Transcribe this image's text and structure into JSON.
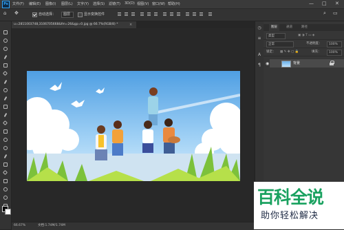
{
  "app": {
    "logo": "Ps"
  },
  "menu": [
    "文件(F)",
    "编辑(E)",
    "图像(I)",
    "图层(L)",
    "文字(Y)",
    "选择(S)",
    "滤镜(T)",
    "3D(D)",
    "视图(V)",
    "窗口(W)",
    "帮助(H)"
  ],
  "window_controls": {
    "minimize": "—",
    "maximize": "□",
    "close": "✕"
  },
  "options": {
    "auto_select_label": "自动选择：",
    "auto_select_value": "图层",
    "show_transform_label": "显示变换控件"
  },
  "document": {
    "tab_title": "u=2811003748,3106705668&fm=26&gp=0.jpg @ 66.7%(RGB/8) *",
    "tab_close": "×"
  },
  "status": {
    "zoom": "66.67%",
    "doc_info": "文档:1.74M/1.74M"
  },
  "panel": {
    "tabs": [
      "图层",
      "通道",
      "路径"
    ],
    "kind_label": "类型",
    "blend_mode": "正常",
    "opacity_label": "不透明度：",
    "opacity_value": "100%",
    "lock_label": "锁定：",
    "fill_label": "填充：",
    "fill_value": "100%",
    "layer_name": "背景"
  },
  "watermark": {
    "title": "百科全说",
    "subtitle": "助你轻松解决"
  },
  "colors": {
    "accent": "#31a8ff",
    "watermark_green": "#19a15f",
    "sky": "#6ab0ea"
  },
  "icons": {
    "toolbar": [
      "move-icon",
      "marquee-icon",
      "lasso-icon",
      "quick-select-icon",
      "crop-icon",
      "frame-icon",
      "eyedropper-icon",
      "healing-icon",
      "brush-icon",
      "stamp-icon",
      "history-brush-icon",
      "eraser-icon",
      "gradient-icon",
      "blur-icon",
      "dodge-icon",
      "pen-icon",
      "type-icon",
      "path-select-icon",
      "rectangle-icon",
      "hand-icon",
      "zoom-icon"
    ]
  }
}
